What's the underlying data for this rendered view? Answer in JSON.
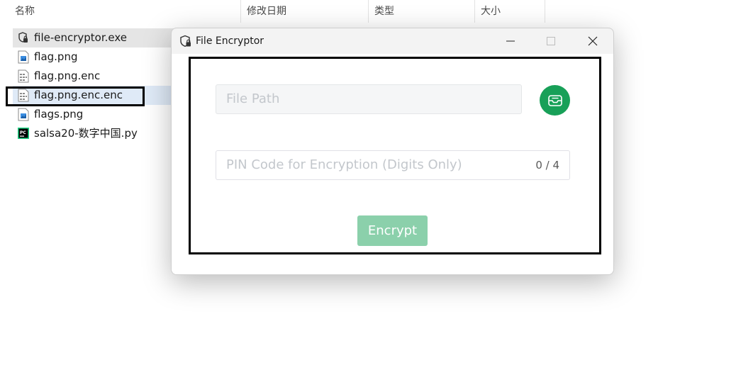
{
  "explorer": {
    "columns": {
      "name": "名称",
      "modified": "修改日期",
      "type": "类型",
      "size": "大小"
    },
    "files": [
      {
        "name": "file-encryptor.exe",
        "icon": "shield-exe-icon",
        "state": "selected"
      },
      {
        "name": "flag.png",
        "icon": "image-file-icon",
        "state": "normal"
      },
      {
        "name": "flag.png.enc",
        "icon": "binary-file-icon",
        "state": "normal"
      },
      {
        "name": "flag.png.enc.enc",
        "icon": "binary-file-icon",
        "state": "highlighted"
      },
      {
        "name": "flags.png",
        "icon": "image-file-icon",
        "state": "normal"
      },
      {
        "name": "salsa20-数字中国.py",
        "icon": "pycharm-file-icon",
        "state": "normal"
      }
    ]
  },
  "dialog": {
    "title": "File Encryptor",
    "path_placeholder": "File Path",
    "pin_placeholder": "PIN Code for Encryption (Digits Only)",
    "pin_counter": "0 / 4",
    "encrypt_label": "Encrypt",
    "browse_icon": "inbox-icon"
  },
  "colors": {
    "accent": "#18a058",
    "accent_disabled": "#8bd0ab",
    "selection": "#e5e5e5",
    "highlight": "#dfeaf7"
  }
}
